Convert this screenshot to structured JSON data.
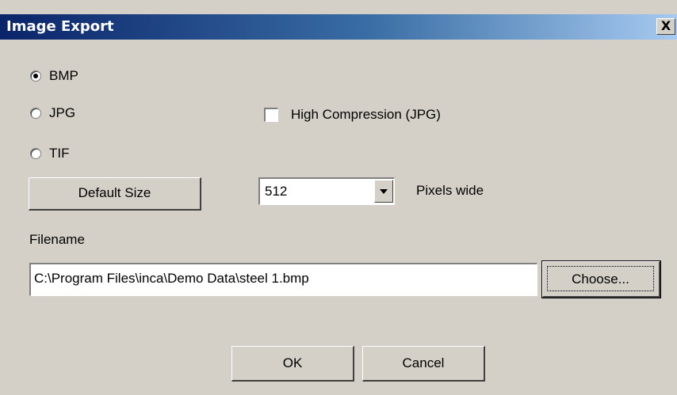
{
  "window": {
    "title": "Image Export",
    "close_label": "X"
  },
  "format": {
    "options": [
      {
        "label": "BMP",
        "checked": true
      },
      {
        "label": "JPG",
        "checked": false
      },
      {
        "label": "TIF",
        "checked": false
      }
    ]
  },
  "compression": {
    "label": "High Compression (JPG)",
    "checked": false
  },
  "size": {
    "default_button": "Default Size",
    "width_value": "512",
    "unit_label": "Pixels wide"
  },
  "filename": {
    "label": "Filename",
    "value": "C:\\Program Files\\inca\\Demo Data\\steel 1.bmp",
    "choose_button": "Choose..."
  },
  "actions": {
    "ok": "OK",
    "cancel": "Cancel"
  }
}
